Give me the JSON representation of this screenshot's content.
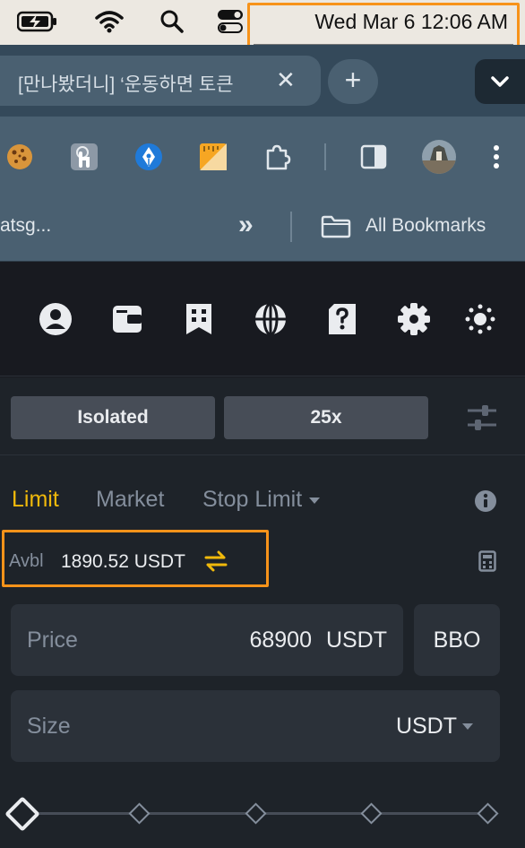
{
  "menubar": {
    "clock": "Wed Mar 6  12:06 AM",
    "icons": [
      "battery-charging-icon",
      "wifi-icon",
      "spotlight-search-icon",
      "control-center-icon"
    ]
  },
  "browser": {
    "tab_title": "[만나봤더니] ‘운동하면 토큰",
    "tab_close": "✕",
    "new_tab": "+",
    "extensions": [
      "cookie-icon",
      "touch-extension-icon",
      "pen-extension-icon",
      "ruler-extension-icon",
      "puzzle-extensions-icon",
      "side-panel-icon",
      "profile-avatar-icon",
      "more-menu-icon"
    ],
    "bookmark_truncated": "atsg...",
    "bookmark_overflow": "»",
    "all_bookmarks": "All Bookmarks"
  },
  "site_header": {
    "icons": [
      "user-icon",
      "wallet-icon",
      "orders-icon",
      "globe-icon",
      "help-icon",
      "settings-icon",
      "theme-icon"
    ]
  },
  "trade": {
    "margin_mode": "Isolated",
    "leverage": "25x",
    "order_tabs": {
      "limit": "Limit",
      "market": "Market",
      "stop_limit": "Stop Limit"
    },
    "available": {
      "label": "Avbl",
      "value": "1890.52 USDT"
    },
    "price": {
      "label": "Price",
      "value": "68900",
      "unit": "USDT",
      "bbo": "BBO"
    },
    "size": {
      "label": "Size",
      "unit": "USDT"
    },
    "slider_percent": 0
  },
  "colors": {
    "accent_yellow": "#f0b90b",
    "highlight_orange": "#f7931a",
    "panel_bg": "#1e2329",
    "header_bg": "#181a20"
  }
}
